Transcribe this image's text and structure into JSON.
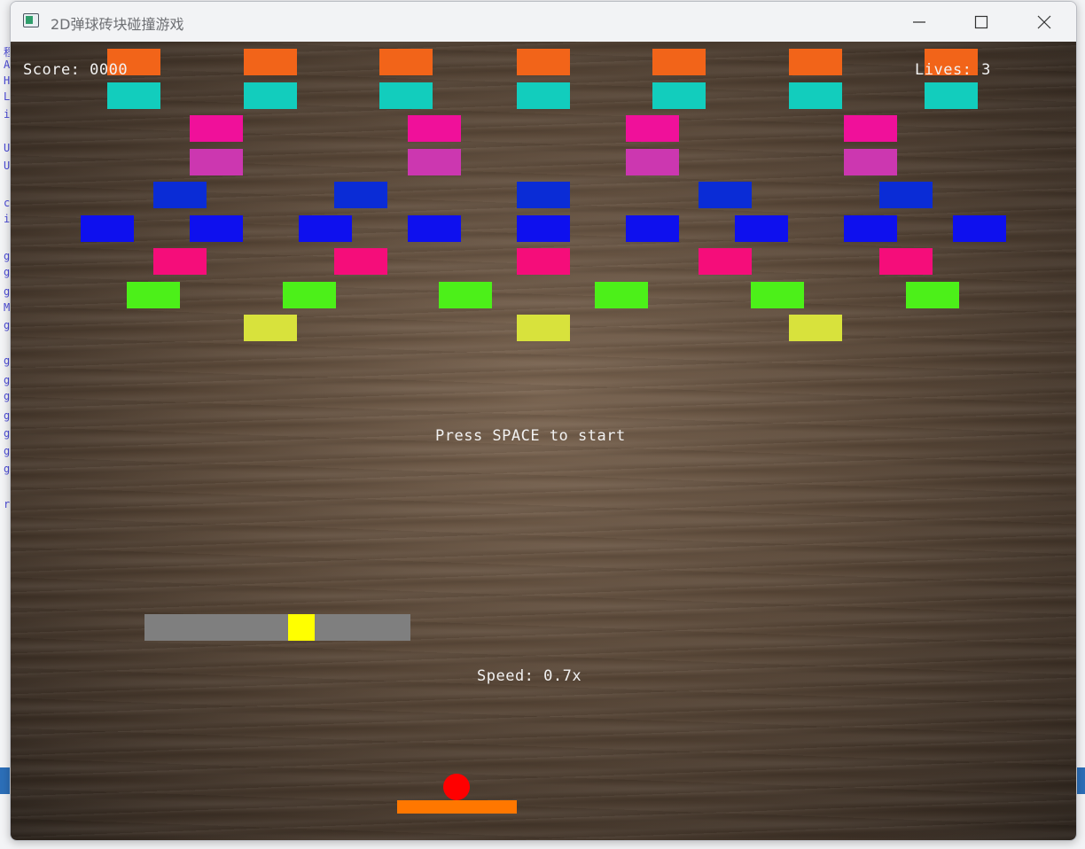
{
  "window": {
    "title": "2D弹球砖块碰撞游戏"
  },
  "background_editor_lines": [
    "程",
    "A",
    "H",
    "L",
    "i",
    "U",
    "U",
    "c",
    "i",
    "g",
    "g",
    "g",
    "M",
    "g",
    "g",
    "g",
    "g",
    "g",
    "g",
    "g",
    "g",
    "r"
  ],
  "hud": {
    "score_text": "Score: 0000",
    "lives_text": "Lives: 3",
    "start_message": "Press SPACE to start",
    "speed_text": "Speed: 0.7x"
  },
  "speed_slider": {
    "fraction": 0.6,
    "track_color": "#7f7f7f",
    "knob_color": "#ffff00"
  },
  "ball": {
    "color": "#ff0000"
  },
  "paddle": {
    "color": "#ff7700"
  },
  "brick_rows": [
    {
      "color": "#f26419",
      "count": 7
    },
    {
      "color": "#12cdbd",
      "count": 7
    },
    {
      "color": "#f0109a",
      "count": 4
    },
    {
      "color": "#cc37b0",
      "count": 4
    },
    {
      "color": "#0a2cd6",
      "count": 5
    },
    {
      "color": "#0e10ee",
      "count": 9
    },
    {
      "color": "#f50d7a",
      "count": 5
    },
    {
      "color": "#4cf019",
      "count": 6
    },
    {
      "color": "#d8e23c",
      "count": 3
    }
  ]
}
